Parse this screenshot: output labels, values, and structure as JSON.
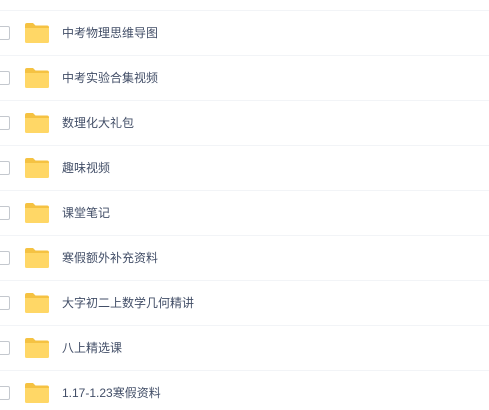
{
  "file_list": {
    "items": [
      {
        "name": "中考物理思维导图",
        "icon": "folder-icon"
      },
      {
        "name": "中考实验合集视频",
        "icon": "folder-icon"
      },
      {
        "name": "数理化大礼包",
        "icon": "folder-icon"
      },
      {
        "name": "趣味视频",
        "icon": "folder-icon"
      },
      {
        "name": "课堂笔记",
        "icon": "folder-icon"
      },
      {
        "name": "寒假额外补充资料",
        "icon": "folder-icon"
      },
      {
        "name": "大字初二上数学几何精讲",
        "icon": "folder-icon"
      },
      {
        "name": "八上精选课",
        "icon": "folder-icon"
      },
      {
        "name": "1.17-1.23寒假资料",
        "icon": "folder-icon"
      }
    ]
  },
  "colors": {
    "folder_front": "#ffd766",
    "folder_back": "#f5c242",
    "text": "#424e67",
    "divider": "#f2f4f7"
  }
}
